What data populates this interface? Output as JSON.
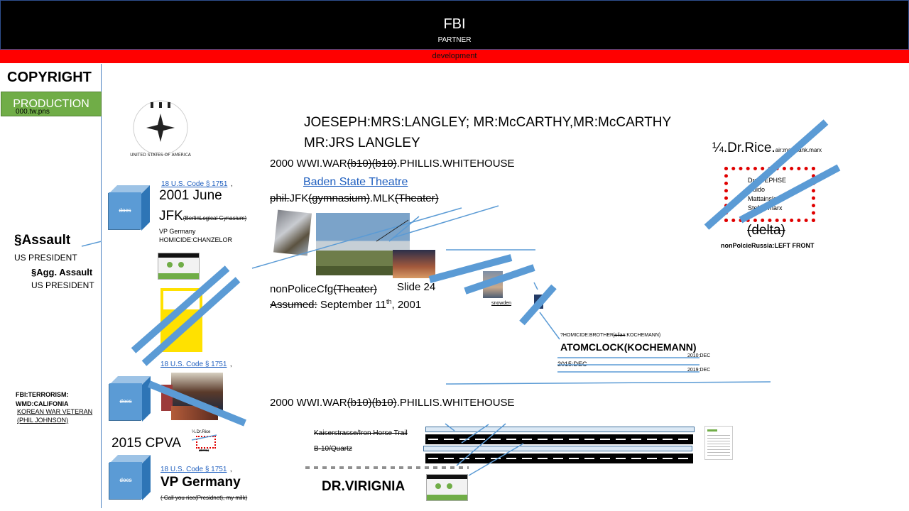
{
  "header": {
    "title": "FBI",
    "subtitle": "PARTNER",
    "band": "development"
  },
  "left": {
    "copyright": "COPYRIGHT",
    "production": "PRODUCTION",
    "production_sub": "000.tw.pns",
    "assault": "§Assault",
    "us_president": "US PRESIDENT",
    "agg_assault": "§Agg. Assault",
    "us_president2": "US PRESIDENT",
    "fbi_terror": "FBI:TERRORISM:",
    "wmd": "WMD:CALIFONIA",
    "korean": "KOREAN WAR VETERAN",
    "phil": "(PHIL JOHNSON)"
  },
  "seal_text": "UNITED STATES OF AMERICA",
  "names_line1": "JOESEPH:MRS:LANGLEY; MR:McCARTHY,MR:McCARTHY",
  "names_line2": "MR:JRS LANGLEY",
  "war1": {
    "pre": "2000  WWI.WAR",
    "strike": "(b10)(b10)",
    "post": ".PHILLIS.WHITEHOUSE"
  },
  "baden": "Baden State Theatre",
  "phil_line": {
    "s1": "phil.",
    "t1": "JFK",
    "s2": "(gymnasium)",
    "t2": ".MLK",
    "s3": "(Theater)"
  },
  "docs_label": "docs",
  "code1": "18 U.S. Code § 1751",
  "code_comma": ",",
  "jfk": {
    "l1": "2001 June",
    "l2": "JFK",
    "l2_small": "(BerlinLogical Gynasium)",
    "vp": "VP Germany",
    "homicide": "HOMICIDE:CHANZELOR"
  },
  "nonpolice": {
    "t": "nonPoliceCfg",
    "s": "(Theater)",
    "slide": "Slide 24",
    "assumed_s": "Assumed:",
    "date": " September 11",
    "th": "th",
    "year": ", 2001"
  },
  "snowden": "snowden",
  "rice": {
    "title": "¼.Dr.Rice.",
    "small": "air:maxplank.marx",
    "list": [
      "Dr:JOEPHSE",
      "Guido",
      "Mattainslend",
      "Stefan marx"
    ],
    "delta": "(delta)",
    "front": "nonPolcieRussia:LEFT FRONT"
  },
  "atom": {
    "homicide": "?HOMICIDE:BROTHER",
    "homicide_s": "julian",
    "homicide_post": ":KOCHEMANN)",
    "title": "ATOMCLOCK(KOCHEMANN)",
    "d2010": "2010:DEC",
    "d2015": "2015:DEC",
    "d2019": "2019:DEC"
  },
  "code2": "18 U.S. Code § 1751",
  "war2": {
    "pre": "2000  WWI.WAR",
    "strike": "(b10)(b10)",
    "post": ".PHILLIS.WHITEHOUSE"
  },
  "cpva": "2015 CPVA",
  "cpva_small": {
    "a": "¼.Dr.Rice",
    "b": "(delta)"
  },
  "code3": "18 U.S. Code § 1751",
  "vp_germany": "VP Germany",
  "call_you": "( Call you rice(Presidnet), my milk)",
  "kaiser": "Kaiserstrasse/Iron Horse Trail",
  "b10": "B-10/Quartz",
  "drv": "DR.VIRIGNIA",
  "colors": {
    "accent": "#5b9bd5",
    "header": "#000000",
    "band": "#ff0000",
    "production": "#70ad47"
  }
}
